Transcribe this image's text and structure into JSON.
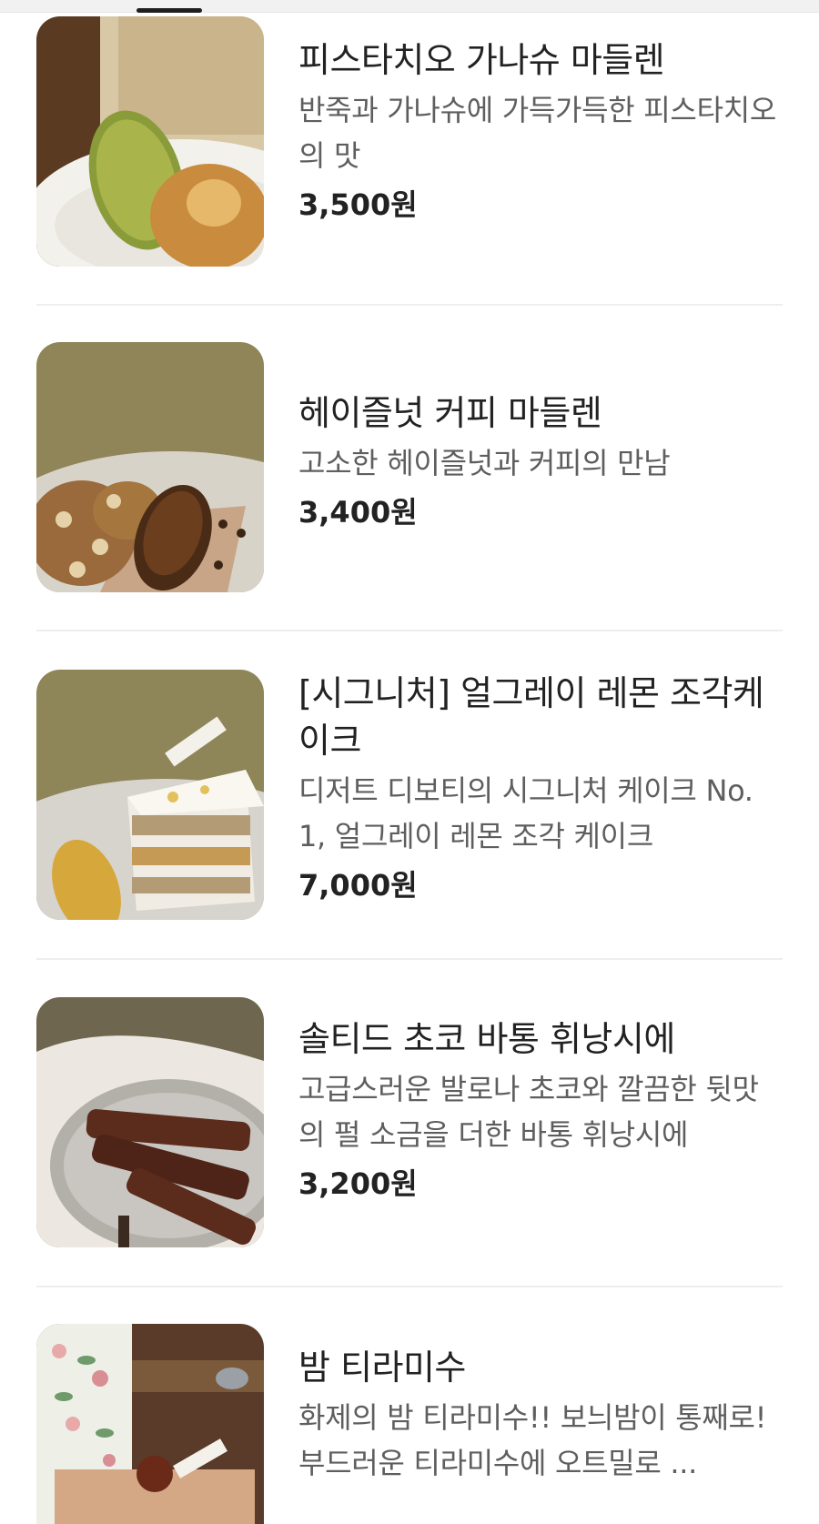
{
  "menu_items": [
    {
      "name": "피스타치오 가나슈 마들렌",
      "description": "반죽과 가나슈에 가득가득한 피스타치오의 맛",
      "price": "3,500원",
      "image_icon": "pistachio-madeleine-photo"
    },
    {
      "name": "헤이즐넛 커피 마들렌",
      "description": "고소한 헤이즐넛과 커피의 만남",
      "price": "3,400원",
      "image_icon": "hazelnut-coffee-madeleine-photo"
    },
    {
      "name": "[시그니처] 얼그레이 레몬 조각케이크",
      "description": "디저트 디보티의 시그니처 케이크 No. 1, 얼그레이 레몬 조각 케이크",
      "price": "7,000원",
      "image_icon": "earl-grey-lemon-cake-photo"
    },
    {
      "name": "솔티드 초코 바통 휘낭시에",
      "description": "고급스러운 발로나 초코와 깔끔한 뒷맛의 펄 소금을 더한 바통 휘낭시에",
      "price": "3,200원",
      "image_icon": "salted-choco-financier-photo"
    },
    {
      "name": "밤 티라미수",
      "description": "화제의 밤 티라미수!! 보늬밤이 통째로! 부드러운 티라미수에 오트밀로 ...",
      "price": "",
      "image_icon": "chestnut-tiramisu-photo"
    }
  ]
}
